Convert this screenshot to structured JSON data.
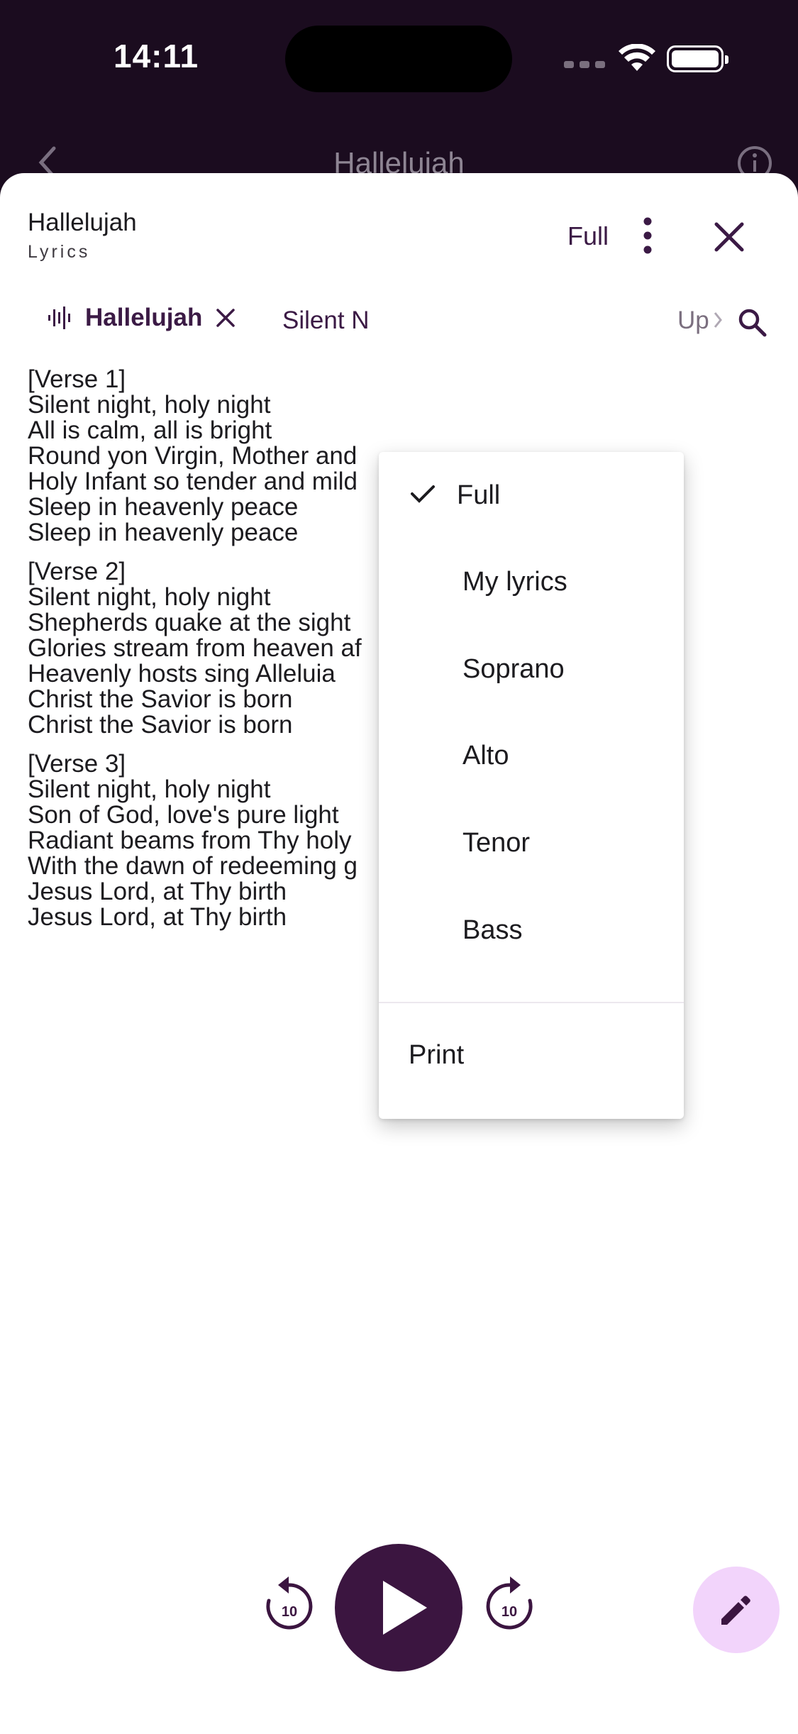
{
  "status_bar": {
    "time": "14:11"
  },
  "background_app": {
    "title": "Hallelujah"
  },
  "sheet": {
    "title": "Hallelujah",
    "subtitle": "Lyrics",
    "mode": "Full"
  },
  "chips": {
    "active": "Hallelujah",
    "second": "Silent N",
    "third": "Up"
  },
  "lyrics": [
    {
      "lines": [
        "[Verse 1]",
        "Silent night, holy night",
        "All is calm, all is bright",
        "Round yon Virgin, Mother and",
        "Holy Infant so tender and mild",
        "Sleep in heavenly peace",
        "Sleep in heavenly peace"
      ]
    },
    {
      "lines": [
        "[Verse 2]",
        "Silent night, holy night",
        "Shepherds quake at the sight",
        "Glories stream from heaven af",
        "Heavenly hosts sing Alleluia",
        "Christ the Savior is born",
        "Christ the Savior is born"
      ]
    },
    {
      "lines": [
        "[Verse 3]",
        "Silent night, holy night",
        "Son of God, love's pure light",
        "Radiant beams from Thy holy",
        "With the dawn of redeeming g",
        "Jesus Lord, at Thy birth",
        "Jesus Lord, at Thy birth"
      ]
    }
  ],
  "menu": {
    "items": [
      {
        "label": "Full",
        "selected": true
      },
      {
        "label": "My lyrics",
        "selected": false
      },
      {
        "label": "Soprano",
        "selected": false
      },
      {
        "label": "Alto",
        "selected": false
      },
      {
        "label": "Tenor",
        "selected": false
      },
      {
        "label": "Bass",
        "selected": false
      }
    ],
    "print_label": "Print"
  },
  "player": {
    "replay_seconds": "10",
    "forward_seconds": "10"
  },
  "colors": {
    "accent": "#3b1540",
    "fab": "#f2d4fb",
    "background": "#1b0c1f"
  },
  "icons": [
    "wifi-icon",
    "battery-icon",
    "back-icon",
    "info-icon",
    "more-vert-icon",
    "close-icon",
    "waveform-icon",
    "chip-close-icon",
    "chevron-right-icon",
    "search-icon",
    "check-icon",
    "replay-10-icon",
    "play-icon",
    "forward-10-icon",
    "edit-icon"
  ]
}
